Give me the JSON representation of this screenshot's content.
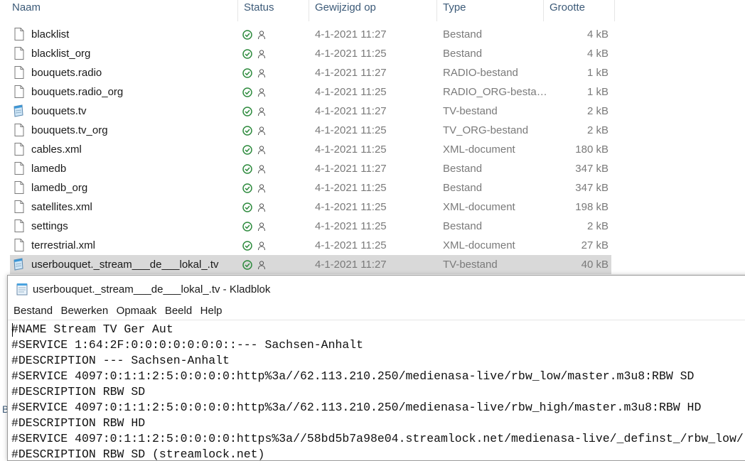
{
  "explorer": {
    "columns": {
      "name": "Naam",
      "status": "Status",
      "modified": "Gewijzigd op",
      "type": "Type",
      "size": "Grootte"
    },
    "files": [
      {
        "name": "blacklist",
        "date": "4-1-2021 11:27",
        "type": "Bestand",
        "size": "4 kB",
        "icon": "file-icon"
      },
      {
        "name": "blacklist_org",
        "date": "4-1-2021 11:25",
        "type": "Bestand",
        "size": "4 kB",
        "icon": "file-icon"
      },
      {
        "name": "bouquets.radio",
        "date": "4-1-2021 11:27",
        "type": "RADIO-bestand",
        "size": "1 kB",
        "icon": "file-icon"
      },
      {
        "name": "bouquets.radio_org",
        "date": "4-1-2021 11:25",
        "type": "RADIO_ORG-besta…",
        "size": "1 kB",
        "icon": "file-icon"
      },
      {
        "name": "bouquets.tv",
        "date": "4-1-2021 11:27",
        "type": "TV-bestand",
        "size": "2 kB",
        "icon": "notepad-file-icon"
      },
      {
        "name": "bouquets.tv_org",
        "date": "4-1-2021 11:25",
        "type": "TV_ORG-bestand",
        "size": "2 kB",
        "icon": "file-icon"
      },
      {
        "name": "cables.xml",
        "date": "4-1-2021 11:25",
        "type": "XML-document",
        "size": "180 kB",
        "icon": "file-icon"
      },
      {
        "name": "lamedb",
        "date": "4-1-2021 11:27",
        "type": "Bestand",
        "size": "347 kB",
        "icon": "file-icon"
      },
      {
        "name": "lamedb_org",
        "date": "4-1-2021 11:25",
        "type": "Bestand",
        "size": "347 kB",
        "icon": "file-icon"
      },
      {
        "name": "satellites.xml",
        "date": "4-1-2021 11:25",
        "type": "XML-document",
        "size": "198 kB",
        "icon": "file-icon"
      },
      {
        "name": "settings",
        "date": "4-1-2021 11:25",
        "type": "Bestand",
        "size": "2 kB",
        "icon": "file-icon"
      },
      {
        "name": "terrestrial.xml",
        "date": "4-1-2021 11:25",
        "type": "XML-document",
        "size": "27 kB",
        "icon": "file-icon"
      },
      {
        "name": "userbouquet._stream___de___lokal_.tv",
        "date": "4-1-2021 11:27",
        "type": "TV-bestand",
        "size": "40 kB",
        "icon": "notepad-file-icon",
        "selected": true
      }
    ],
    "status_icons": [
      "synced-check-icon",
      "person-icon"
    ],
    "cutoff_letter": "B",
    "colors": {
      "header": "#3c5a78",
      "check": "#2e8b3e",
      "selected_row": "#d9d9d9"
    }
  },
  "notepad": {
    "title": "userbouquet._stream___de___lokal_.tv - Kladblok",
    "menu": [
      "Bestand",
      "Bewerken",
      "Opmaak",
      "Beeld",
      "Help"
    ],
    "lines": [
      "#NAME Stream TV Ger Aut",
      "#SERVICE 1:64:2F:0:0:0:0:0:0:0::--- Sachsen-Anhalt",
      "#DESCRIPTION --- Sachsen-Anhalt",
      "#SERVICE 4097:0:1:1:2:5:0:0:0:0:http%3a//62.113.210.250/medienasa-live/rbw_low/master.m3u8:RBW SD",
      "#DESCRIPTION RBW SD",
      "#SERVICE 4097:0:1:1:2:5:0:0:0:0:http%3a//62.113.210.250/medienasa-live/rbw_high/master.m3u8:RBW HD",
      "#DESCRIPTION RBW HD",
      "#SERVICE 4097:0:1:1:2:5:0:0:0:0:https%3a//58bd5b7a98e04.streamlock.net/medienasa-live/_definst_/rbw_low/",
      "#DESCRIPTION RBW SD (streamlock.net)"
    ]
  }
}
